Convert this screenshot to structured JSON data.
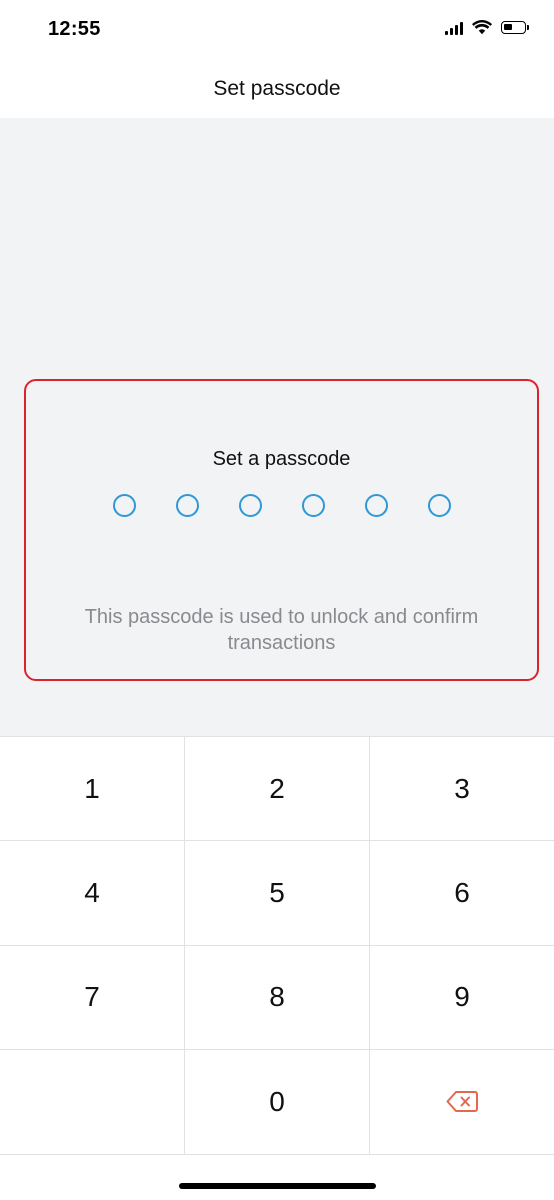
{
  "status_bar": {
    "time": "12:55",
    "icons": [
      "signal-icon",
      "wifi-icon",
      "battery-icon"
    ],
    "battery_level": 0.35
  },
  "header": {
    "title": "Set passcode"
  },
  "passcode": {
    "title": "Set a passcode",
    "digit_count": 6,
    "entered": 0,
    "hint": "This passcode is used to unlock and confirm transactions"
  },
  "keypad": {
    "keys": [
      "1",
      "2",
      "3",
      "4",
      "5",
      "6",
      "7",
      "8",
      "9",
      "",
      "0"
    ],
    "backspace_icon": "backspace-icon"
  },
  "colors": {
    "accent": "#2f98d6",
    "highlight_border": "#d9232e",
    "backspace": "#e5674f",
    "background": "#f2f3f5"
  }
}
